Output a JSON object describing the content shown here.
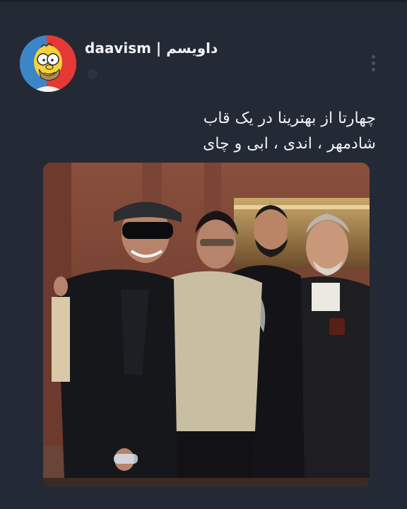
{
  "post": {
    "username": "daavism | داویسم",
    "caption_line1": "چهارتا از بهترینا در یک قاب",
    "caption_line2": "شادمهر ، اندی ، ابی و چای"
  },
  "icons": {
    "avatar": "homer-simpson-avatar",
    "menu": "more-vertical-icon"
  },
  "colors": {
    "background": "#232a35",
    "avatar_ring": "#e53935",
    "text": "#f0f1f4"
  }
}
